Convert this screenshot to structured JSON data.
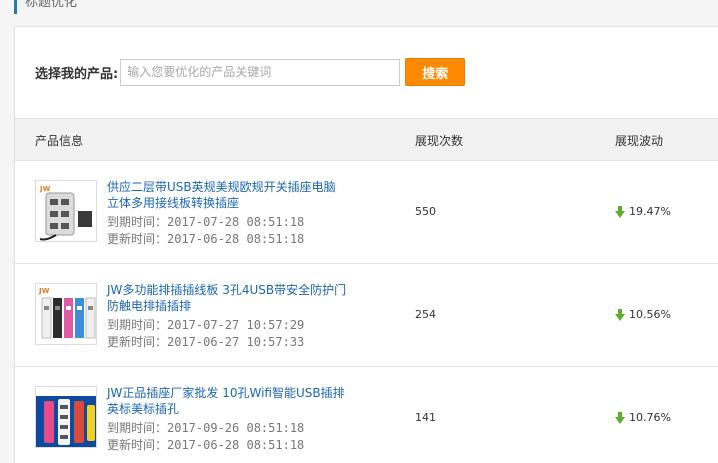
{
  "section": {
    "title": "标题优化"
  },
  "search": {
    "label": "选择我的产品:",
    "placeholder": "输入您要优化的产品关键词",
    "button": "搜索"
  },
  "table": {
    "headers": {
      "info": "产品信息",
      "views": "展现次数",
      "fluctuation": "展现波动"
    },
    "rows": [
      {
        "title": "供应二层带USB英规美规欧规开关插座电脑立体多用接线板转换插座",
        "expire": "到期时间：2017-07-28 08:51:18",
        "update": "更新时间：2017-06-28 08:51:18",
        "views": "550",
        "fluctuation": "19.47%",
        "trend": "down",
        "thumb_icon": "power-strip-tower-image"
      },
      {
        "title": "JW多功能排插插线板 3孔4USB带安全防护门防触电排插插排",
        "expire": "到期时间：2017-07-27 10:57:29",
        "update": "更新时间：2017-06-27 10:57:33",
        "views": "254",
        "fluctuation": "10.56%",
        "trend": "down",
        "thumb_icon": "power-strip-multi-image"
      },
      {
        "title": "JW正品插座厂家批发 10孔Wifi智能USB插排英标美标插孔",
        "expire": "到期时间：2017-09-26 08:51:18",
        "update": "更新时间：2017-06-28 08:51:18",
        "views": "141",
        "fluctuation": "10.76%",
        "trend": "down",
        "thumb_icon": "power-tower-blue-image"
      }
    ]
  },
  "colors": {
    "accent": "#1e7ac7",
    "button": "#ff8a00",
    "link": "#1a66b3",
    "arrow": "#5fae2e"
  }
}
